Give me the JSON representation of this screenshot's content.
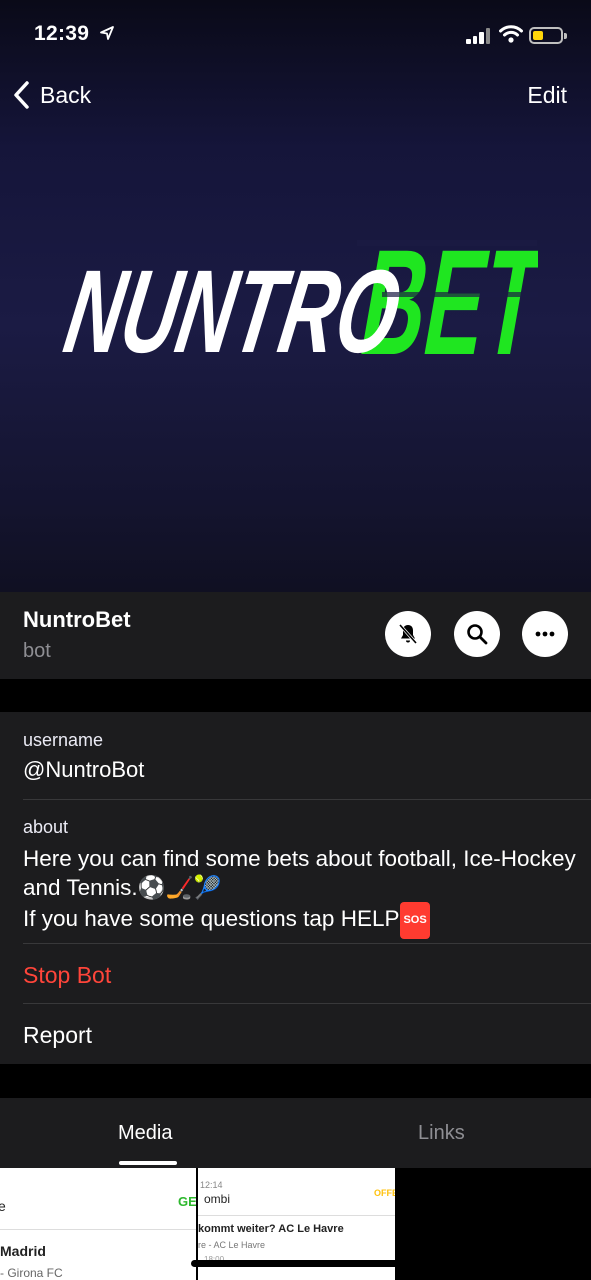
{
  "status_bar": {
    "time": "12:39",
    "location_icon": "location-arrow-icon"
  },
  "nav": {
    "back_label": "Back",
    "edit_label": "Edit"
  },
  "logo": {
    "white_text": "NUNTRO",
    "green_text": "BET",
    "green_color": "#1fe620"
  },
  "profile": {
    "name": "NuntroBet",
    "subtitle": "bot",
    "actions": [
      "mute-icon",
      "search-icon",
      "more-icon"
    ]
  },
  "info": {
    "username_label": "username",
    "username_value": "@NuntroBot",
    "about_label": "about",
    "about_line1": "Here you can find some bets about football, Ice-Hockey and Tennis.",
    "about_emoji": "⚽🏒🎾",
    "about_line2": "If you have some questions tap HELP",
    "sos_badge": "SOS",
    "stop_bot": "Stop Bot",
    "report": "Report"
  },
  "tabs": {
    "media": "Media",
    "links": "Links"
  },
  "media_thumbs": [
    {
      "header_left": "e",
      "header_right": "GE",
      "line1": "Madrid",
      "line2": "- Girona FC"
    },
    {
      "header_left": "12:14",
      "header_sub": "ombi",
      "header_right": "OFFE",
      "line1": "kommt weiter? AC Le Havre",
      "line2": "re - AC Le Havre",
      "line3": "18:00"
    }
  ],
  "colors": {
    "accent_red": "#ff453a",
    "background": "#000000",
    "surface": "#1c1c1e"
  }
}
